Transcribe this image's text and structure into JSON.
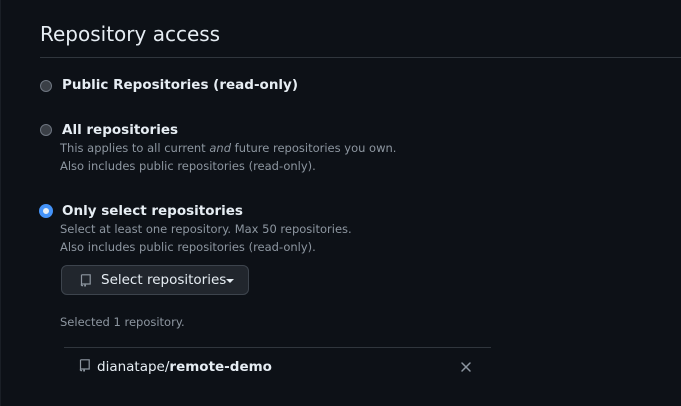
{
  "section": {
    "title": "Repository access"
  },
  "options": [
    {
      "label": "Public Repositories (read-only)",
      "selected": false
    },
    {
      "label": "All repositories",
      "note_line1_before": "This applies to all current ",
      "note_line1_em": "and",
      "note_line1_after": " future repositories you own.",
      "note_line2": "Also includes public repositories (read-only).",
      "selected": false
    },
    {
      "label": "Only select repositories",
      "note_line1": "Select at least one repository. Max 50 repositories.",
      "note_line2": "Also includes public repositories (read-only).",
      "selected": true
    }
  ],
  "select_button": {
    "label": "Select repositories",
    "icon": "repo-icon"
  },
  "selected_summary": "Selected 1 repository.",
  "selected_repos": [
    {
      "owner": "dianatape/",
      "name": "remote-demo",
      "icon": "repo-icon",
      "remove_icon": "close-icon"
    }
  ],
  "colors": {
    "background": "#0d1117",
    "accent": "#4493f8",
    "muted_text": "#8d96a0",
    "border": "#30363d"
  }
}
